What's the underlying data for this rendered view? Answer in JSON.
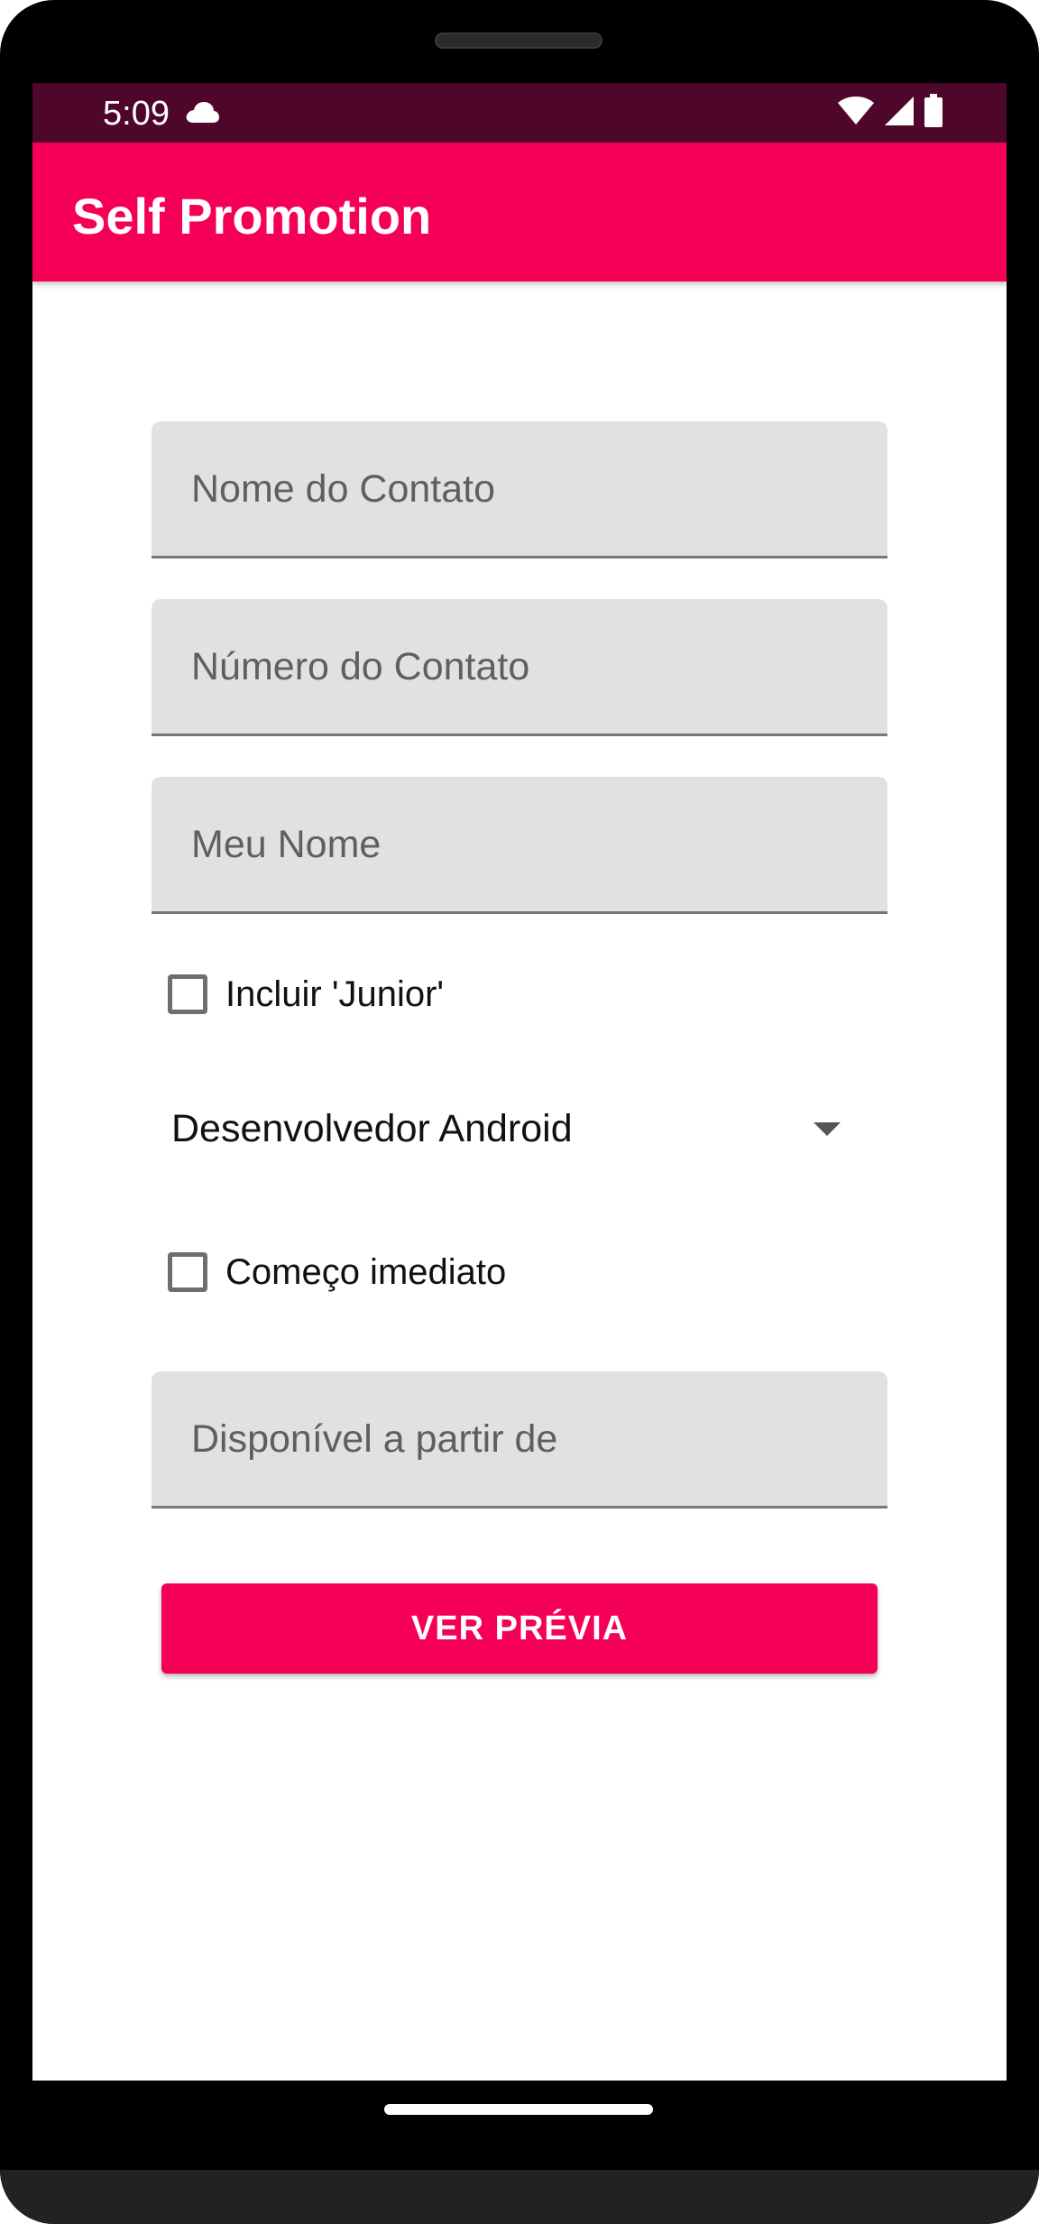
{
  "status_bar": {
    "time": "5:09",
    "background_color": "#4f062b",
    "icons": [
      "cloud-icon",
      "wifi-icon",
      "signal-icon",
      "battery-icon"
    ]
  },
  "app_bar": {
    "title": "Self Promotion",
    "color": "#f50057"
  },
  "form": {
    "contact_name": {
      "placeholder": "Nome do Contato",
      "value": ""
    },
    "contact_number": {
      "placeholder": "Número do Contato",
      "value": ""
    },
    "my_name": {
      "placeholder": "Meu Nome",
      "value": ""
    },
    "include_junior": {
      "label": "Incluir 'Junior'",
      "checked": false
    },
    "job_title": {
      "selected": "Desenvolvedor Android"
    },
    "immediate_start": {
      "label": "Começo imediato",
      "checked": false
    },
    "available_from": {
      "placeholder": "Disponível a partir de",
      "value": ""
    },
    "preview_button": {
      "label": "VER PRÉVIA"
    }
  }
}
